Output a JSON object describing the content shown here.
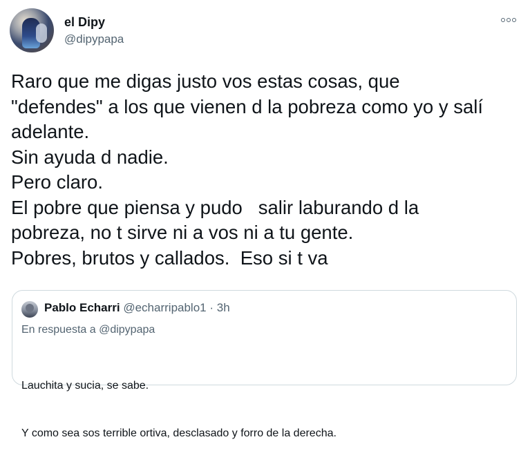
{
  "author": {
    "display_name": "el Dipy",
    "handle": "@dipypapa",
    "avatar_icon": "profile-photo-icon"
  },
  "more_icon": "more-options-icon",
  "tweet": {
    "lines": [
      "Raro que me digas justo vos estas cosas, que",
      "\"defendes\" a los que vienen d la pobreza como yo y salí",
      "adelante.",
      "Sin ayuda d nadie.",
      "Pero claro.",
      "El pobre que piensa y pudo   salir laburando d la",
      "pobreza, no t sirve ni a vos ni a tu gente.",
      "Pobres, brutos y callados.  Eso si t va"
    ]
  },
  "quoted_tweet": {
    "display_name": "Pablo Echarri",
    "handle": "@echarripablo1",
    "separator": "·",
    "time": "3h",
    "reply_prefix": "En respuesta a",
    "reply_mention": "@dipypapa",
    "lines": [
      "Lauchita y sucia, se sabe.",
      "Y como sea sos terrible ortiva, desclasado y forro de la derecha."
    ]
  },
  "colors": {
    "text_primary": "#0f1419",
    "text_secondary": "#536471",
    "border": "#cfd9de",
    "background": "#ffffff"
  }
}
